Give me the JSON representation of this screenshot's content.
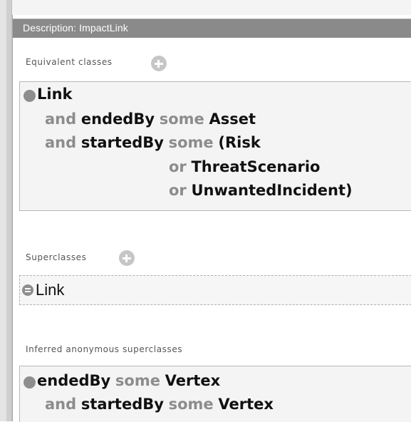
{
  "title": "Description: ImpactLink",
  "sections": {
    "equivalent": {
      "label": "Equivalent classes",
      "expression": {
        "class": "Link",
        "k_and_1": "and",
        "p1": "endedBy",
        "q1": "some",
        "c1": "Asset",
        "k_and_2": "and",
        "p2": "startedBy",
        "q2": "some",
        "c2": "(Risk",
        "k_or_1": "or",
        "c3": "ThreatScenario",
        "k_or_2": "or",
        "c4": "UnwantedIncident)"
      }
    },
    "superclasses": {
      "label": "Superclasses",
      "item": "Link"
    },
    "inferred": {
      "label": "Inferred anonymous superclasses",
      "expression": {
        "p1": "endedBy",
        "q1": "some",
        "c1": "Vertex",
        "k_and": "and",
        "p2": "startedBy",
        "q2": "some",
        "c2": "Vertex"
      }
    }
  },
  "icons": {
    "add": "add-circle-icon",
    "bullet": "filled-circle-icon",
    "asserted": "lines-circle-icon"
  }
}
